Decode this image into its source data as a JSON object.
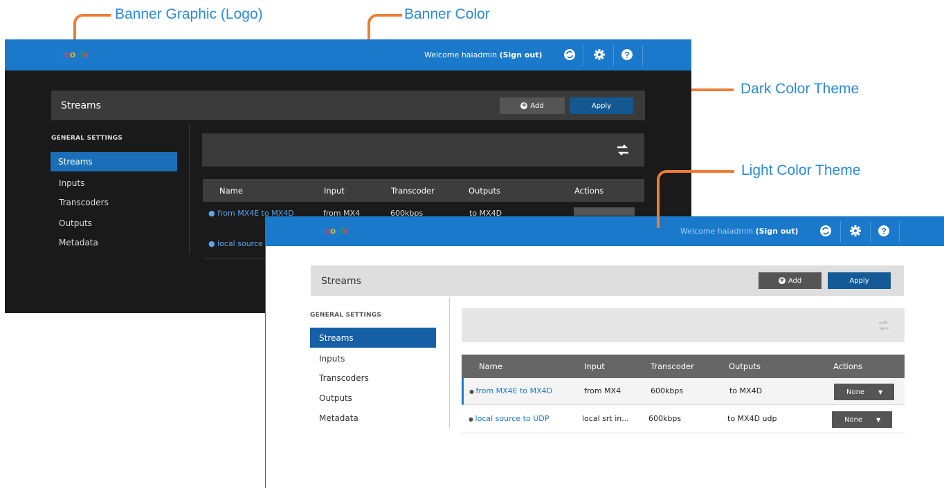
{
  "callouts": {
    "banner_graphic": "Banner Graphic (Logo)",
    "banner_color": "Banner Color",
    "dark_theme": "Dark Color Theme",
    "light_theme": "Light Color Theme"
  },
  "colors": {
    "accent": "#ee7d34",
    "banner": "#1b79cc",
    "label": "#2a8ad8"
  },
  "header": {
    "logo": "Google",
    "welcome": "Welcome haiadmin",
    "sign_out": "(Sign out)",
    "icons": [
      "sync-icon",
      "gear-icon",
      "help-icon"
    ]
  },
  "panel": {
    "title": "Streams",
    "add_label": "Add",
    "apply_label": "Apply"
  },
  "sidebar": {
    "heading": "GENERAL SETTINGS",
    "items": [
      "Streams",
      "Inputs",
      "Transcoders",
      "Outputs",
      "Metadata"
    ],
    "selected": "Streams"
  },
  "table": {
    "columns": [
      "Name",
      "Input",
      "Transcoder",
      "Outputs",
      "Actions"
    ],
    "rows": [
      {
        "name": "from MX4E to MX4D",
        "input": "from MX4",
        "transcoder": "600kbps",
        "outputs": "to MX4D",
        "action": "None"
      },
      {
        "name": "local source to UDP",
        "input": "local srt in...",
        "transcoder": "600kbps",
        "outputs": "to MX4D udp",
        "action": "None"
      }
    ]
  },
  "dark_partial": {
    "row1_name": "from MX4E to MX4D",
    "row1_input": "from MX4",
    "row1_transcoder": "600kbps",
    "row1_outputs": "to MX4D",
    "row2_name": "local source"
  }
}
